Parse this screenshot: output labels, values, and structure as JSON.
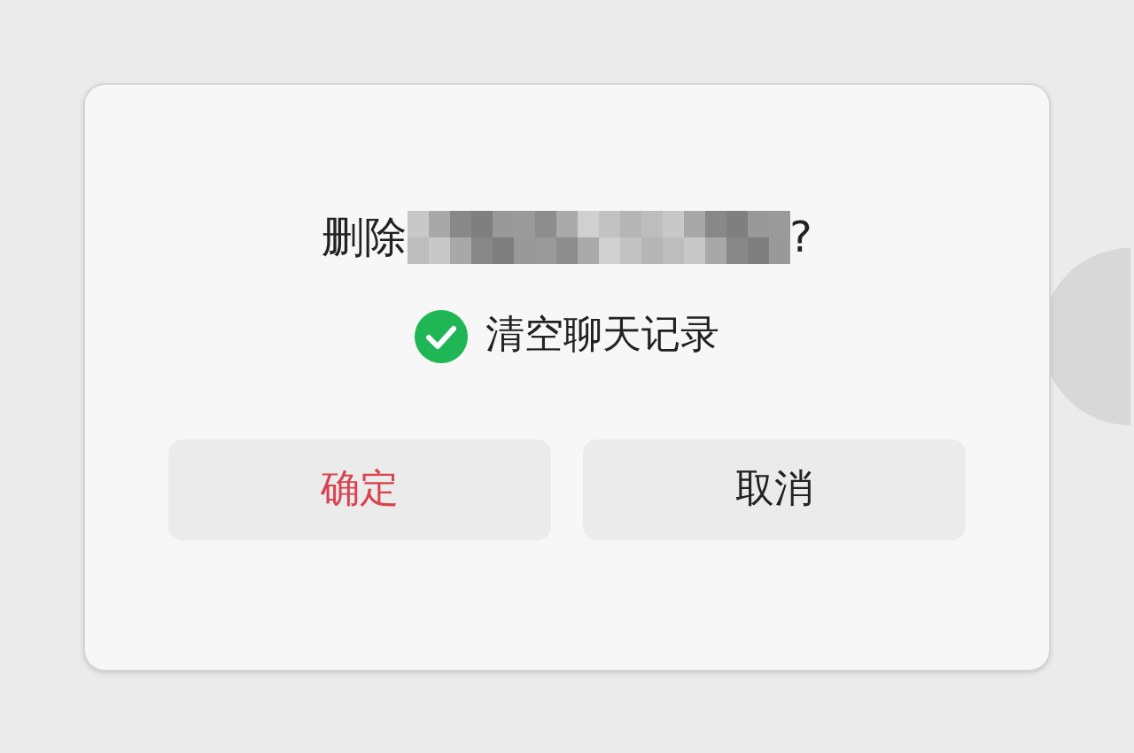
{
  "dialog": {
    "title_prefix": "删除",
    "title_suffix": "?",
    "redacted": true,
    "option": {
      "label": "清空聊天记录",
      "checked": true
    },
    "buttons": [
      {
        "label": "确定",
        "kind": "danger"
      },
      {
        "label": "取消",
        "kind": "normal"
      }
    ]
  }
}
